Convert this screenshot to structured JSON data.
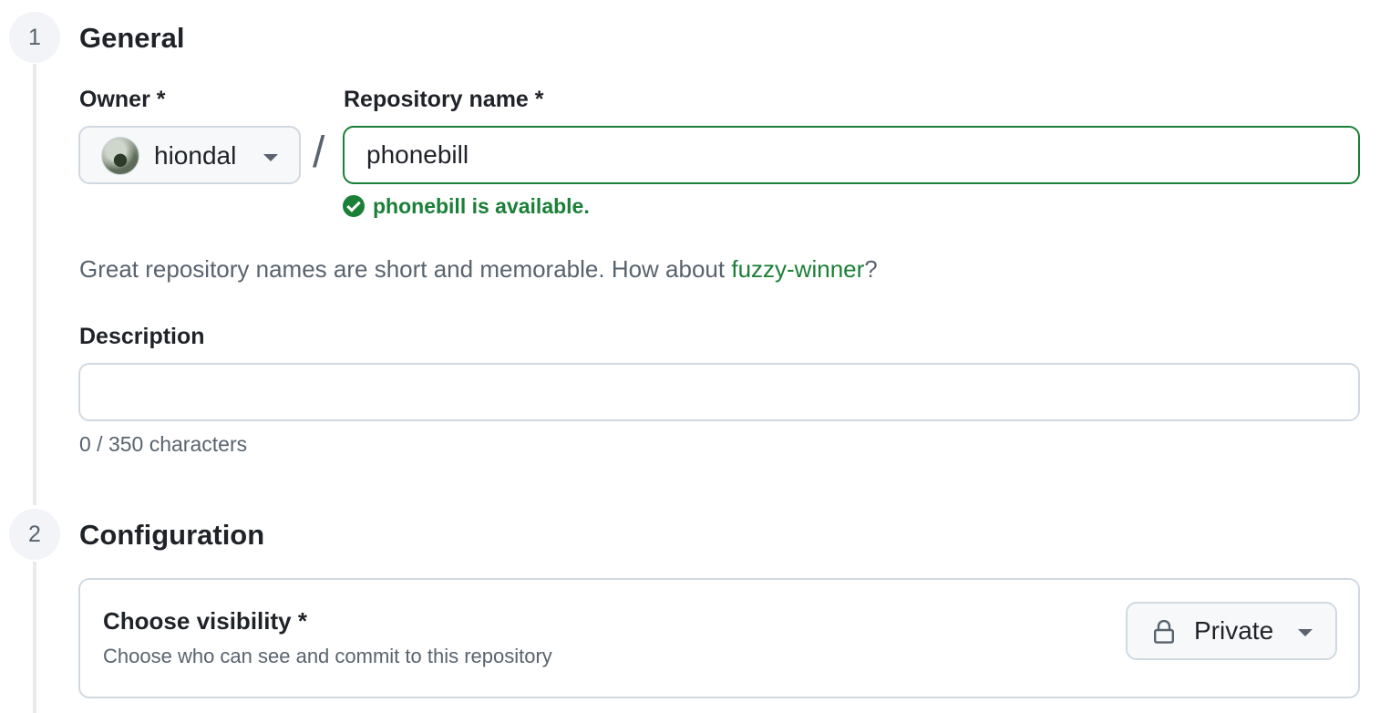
{
  "steps": [
    {
      "number": "1",
      "title": "General"
    },
    {
      "number": "2",
      "title": "Configuration"
    }
  ],
  "general": {
    "owner_label": "Owner *",
    "owner_value": "hiondal",
    "separator": "/",
    "repo_label": "Repository name *",
    "repo_value": "phonebill",
    "availability_message": "phonebill is available.",
    "hint_prefix": "Great repository names are short and memorable. How about ",
    "hint_suggestion": "fuzzy-winner",
    "hint_suffix": "?",
    "description_label": "Description",
    "description_value": "",
    "description_counter": "0 / 350 characters"
  },
  "configuration": {
    "visibility_title": "Choose visibility *",
    "visibility_subtitle": "Choose who can see and commit to this repository",
    "visibility_value": "Private"
  },
  "colors": {
    "success": "#1a7f37",
    "muted_text": "#59636e",
    "border": "#d1d9e0",
    "text": "#1f2328"
  },
  "icons": {
    "availability": "check-circle-icon",
    "visibility": "lock-icon",
    "dropdown": "chevron-down-icon"
  }
}
